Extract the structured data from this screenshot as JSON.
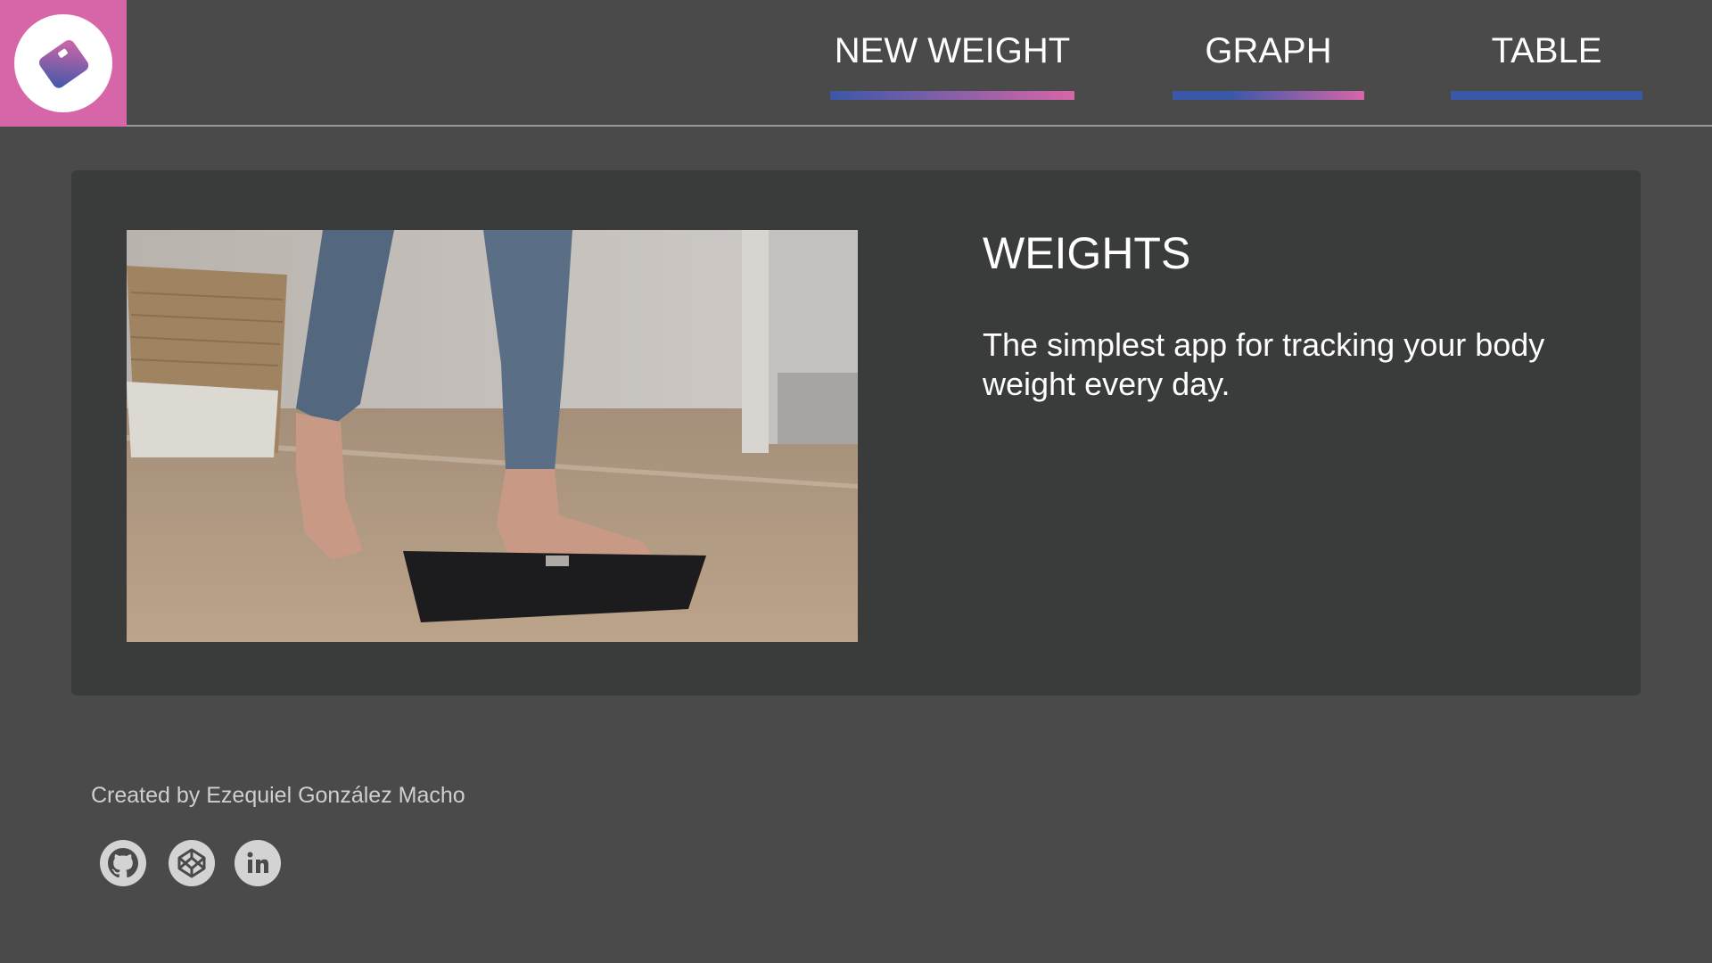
{
  "nav": {
    "items": [
      {
        "label": "NEW WEIGHT"
      },
      {
        "label": "GRAPH"
      },
      {
        "label": "TABLE"
      }
    ]
  },
  "hero": {
    "title": "WEIGHTS",
    "description": "The simplest app for tracking your body weight every day."
  },
  "footer": {
    "credit": "Created by Ezequiel González Macho",
    "social": [
      {
        "icon": "github-icon"
      },
      {
        "icon": "codepen-icon"
      },
      {
        "icon": "linkedin-icon"
      }
    ]
  },
  "colors": {
    "background": "#4a4a4a",
    "card": "#3a3b3b",
    "accent_pink": "#d766a8",
    "accent_blue": "#3a58a8"
  }
}
